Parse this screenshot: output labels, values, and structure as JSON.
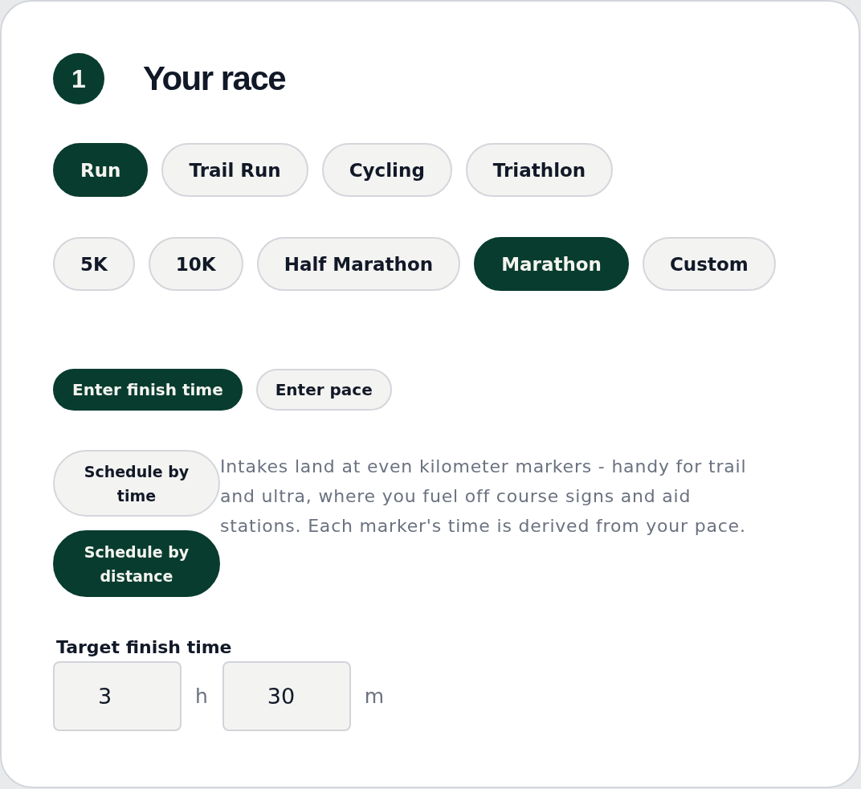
{
  "step": {
    "number": "1",
    "title": "Your race"
  },
  "sports": [
    {
      "label": "Run",
      "selected": true
    },
    {
      "label": "Trail Run",
      "selected": false
    },
    {
      "label": "Cycling",
      "selected": false
    },
    {
      "label": "Triathlon",
      "selected": false
    }
  ],
  "distances": [
    {
      "label": "5K",
      "selected": false
    },
    {
      "label": "10K",
      "selected": false
    },
    {
      "label": "Half Marathon",
      "selected": false
    },
    {
      "label": "Marathon",
      "selected": true
    },
    {
      "label": "Custom",
      "selected": false
    }
  ],
  "input_modes": [
    {
      "label": "Enter finish time",
      "selected": true
    },
    {
      "label": "Enter pace",
      "selected": false
    }
  ],
  "schedule_modes": [
    {
      "label": "Schedule by time",
      "selected": false
    },
    {
      "label": "Schedule by distance",
      "selected": true
    }
  ],
  "schedule_description": "Intakes land at even kilometer markers - handy for trail and ultra, where you fuel off course signs and aid stations. Each marker's time is derived from your pace.",
  "target_time": {
    "label": "Target finish time",
    "fields": [
      {
        "value": "3",
        "unit": "h"
      },
      {
        "value": "30",
        "unit": "m"
      }
    ]
  }
}
